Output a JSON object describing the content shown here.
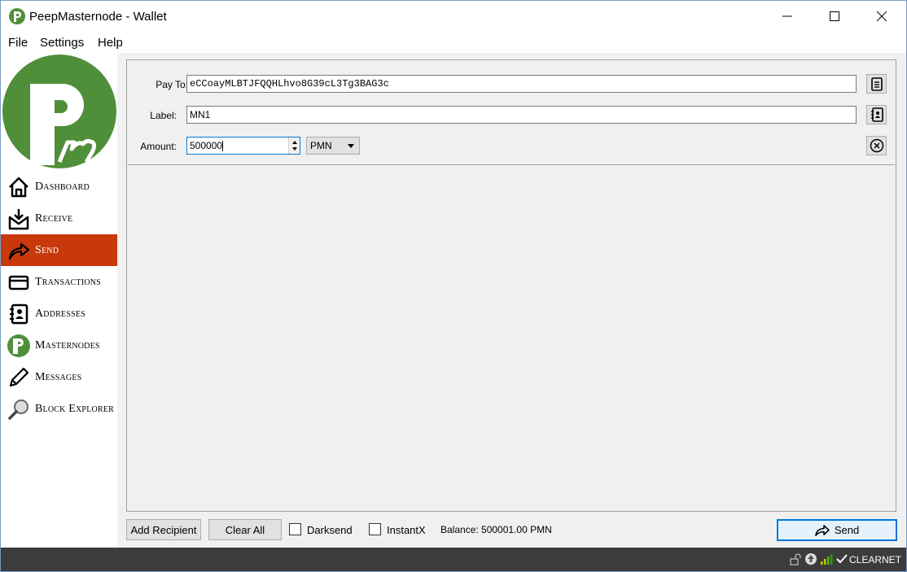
{
  "window": {
    "title": "PeepMasternode - Wallet"
  },
  "menu": {
    "file": "File",
    "settings": "Settings",
    "help": "Help"
  },
  "sidebar": {
    "items": [
      {
        "label": "Dashboard",
        "icon": "home-icon"
      },
      {
        "label": "Receive",
        "icon": "receive-icon"
      },
      {
        "label": "Send",
        "icon": "send-icon",
        "active": true
      },
      {
        "label": "Transactions",
        "icon": "card-icon"
      },
      {
        "label": "Addresses",
        "icon": "address-book-icon"
      },
      {
        "label": "Masternodes",
        "icon": "masternode-logo-icon"
      },
      {
        "label": "Messages",
        "icon": "pencil-icon"
      },
      {
        "label": "Block Explorer",
        "icon": "magnifier-icon"
      }
    ]
  },
  "entry": {
    "pay_to_label": "Pay To:",
    "pay_to_value": "eCCoayMLBTJFQQHLhvo8G39cL3Tg3BAG3c",
    "label_label": "Label:",
    "label_value": "MN1",
    "amount_label": "Amount:",
    "amount_value": "500000",
    "unit": "PMN"
  },
  "footer": {
    "add_recipient": "Add Recipient",
    "clear_all": "Clear All",
    "darksend": "Darksend",
    "instantx": "InstantX",
    "balance": "Balance: 500001.00 PMN",
    "send": "Send"
  },
  "status": {
    "network": "CLEARNET"
  },
  "colors": {
    "accent": "#c8380b",
    "brand_green": "#4f8f3a",
    "focus": "#0078d7"
  }
}
